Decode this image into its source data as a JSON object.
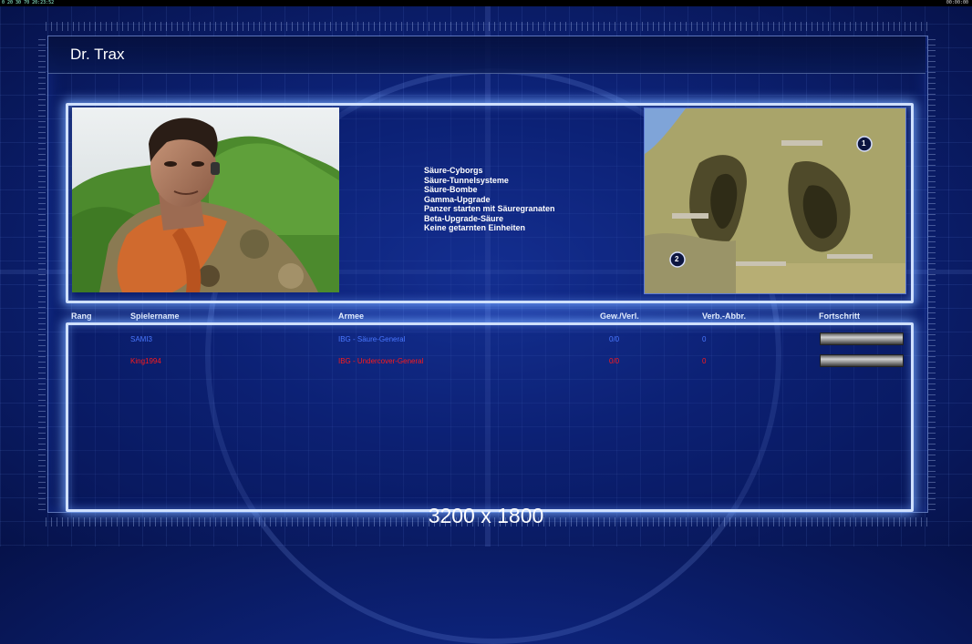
{
  "topbar": {
    "left": "0 20 30 70 20:23:52",
    "right": "00:00:00"
  },
  "title": "Dr. Trax",
  "features": [
    "Säure-Cyborgs",
    "Säure-Tunnelsysteme",
    "Säure-Bombe",
    "Gamma-Upgrade",
    "Panzer starten mit Säuregranaten",
    "Beta-Upgrade-Säure",
    "Keine getarnten Einheiten"
  ],
  "map": {
    "start_markers": [
      "1",
      "2"
    ]
  },
  "columns": {
    "rank": "Rang",
    "player": "Spielername",
    "army": "Armee",
    "winloss": "Gew./Verl.",
    "disconnects": "Verb.-Abbr.",
    "progress": "Fortschritt"
  },
  "players": [
    {
      "rank": "",
      "name": "SAMI3",
      "army": "IBG - Säure-General",
      "winloss": "0/0",
      "disconnects": "0",
      "progress": 0.0,
      "color": "#4a78ff"
    },
    {
      "rank": "",
      "name": "King1994",
      "army": "IBG - Undercover-General",
      "winloss": "0/0",
      "disconnects": "0",
      "progress": 0.0,
      "color": "#ff1a1a"
    }
  ],
  "resolution_label": "3200 x 1800",
  "colors": {
    "accent": "#cfe0ff",
    "background": "#0d237a"
  }
}
